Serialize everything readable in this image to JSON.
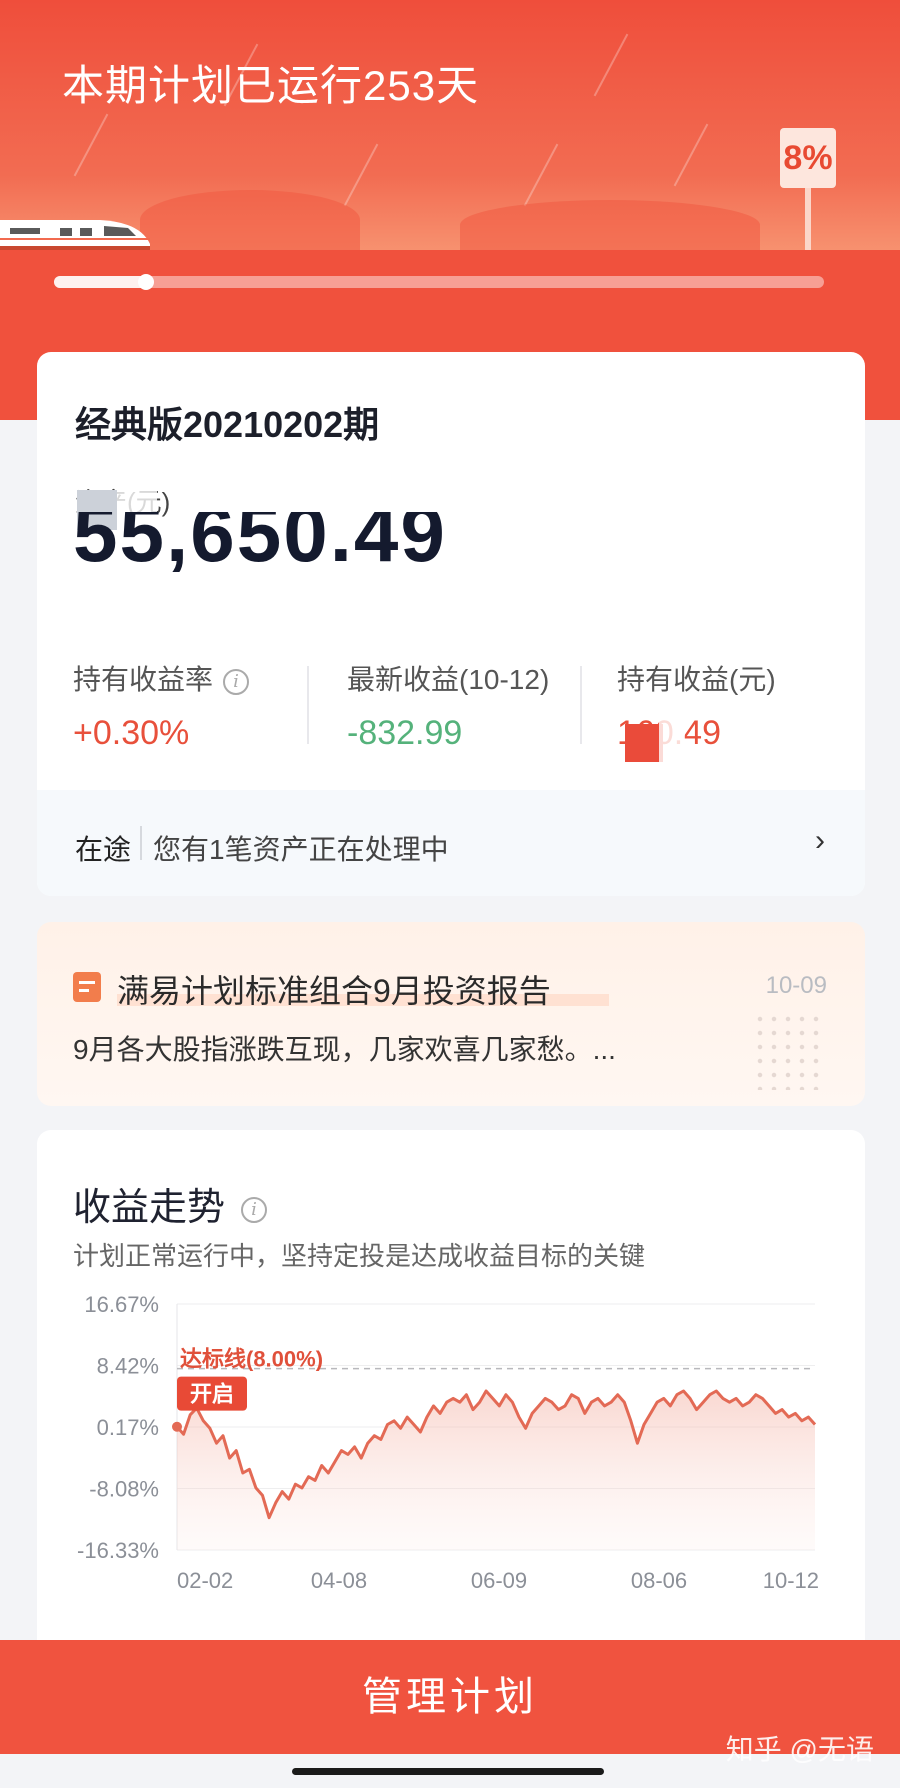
{
  "header": {
    "title": "本期计划已运行253天",
    "target_sign": "8%",
    "progress_fraction": 0.12
  },
  "asset_card": {
    "plan_name": "经典版20210202期",
    "asset_label": "资产(元)",
    "asset_value": "55,650.49",
    "stats": [
      {
        "label": "持有收益率",
        "value": "+0.30%",
        "color": "red",
        "has_info": true
      },
      {
        "label": "最新收益(10-12)",
        "value": "-832.99",
        "color": "green",
        "has_info": false
      },
      {
        "label": "持有收益(元)",
        "value": "160.49",
        "color": "red",
        "has_info": false
      }
    ],
    "in_progress": {
      "tag": "在途",
      "text": "您有1笔资产正在处理中",
      "arrow": "›"
    }
  },
  "report": {
    "title": "满易计划标准组合9月投资报告",
    "date": "10-09",
    "summary": "9月各大股指涨跌互现，几家欢喜几家愁。..."
  },
  "chart_section": {
    "title": "收益走势",
    "subtitle": "计划正常运行中，坚持定投是达成收益目标的关键",
    "start_tag": "开启",
    "target_label": "达标线(8.00%)"
  },
  "chart_data": {
    "type": "area",
    "y_ticks": [
      "16.67%",
      "8.42%",
      "0.17%",
      "-8.08%",
      "-16.33%"
    ],
    "ylim": [
      -16.33,
      16.67
    ],
    "x_ticks": [
      "02-02",
      "04-08",
      "06-09",
      "08-06",
      "10-12"
    ],
    "target_line": 8.0,
    "line_color": "#e36a55",
    "series": [
      {
        "values": [
          0.2,
          -0.8,
          1.8,
          2.7,
          1.0,
          0.0,
          -2.0,
          -1.0,
          -4.0,
          -3.0,
          -6.0,
          -5.5,
          -8.0,
          -9.0,
          -12.0,
          -10.0,
          -8.5,
          -9.5,
          -7.5,
          -8.0,
          -6.5,
          -7.0,
          -5.0,
          -6.0,
          -4.5,
          -3.0,
          -3.5,
          -2.5,
          -4.0,
          -2.0,
          -1.0,
          -1.5,
          0.5,
          1.0,
          0.0,
          1.5,
          0.5,
          -0.5,
          1.5,
          3.0,
          2.0,
          3.5,
          4.0,
          3.5,
          4.5,
          2.5,
          3.5,
          5.0,
          4.0,
          3.0,
          4.5,
          3.5,
          1.5,
          0.0,
          2.0,
          3.0,
          4.0,
          3.5,
          2.5,
          3.0,
          4.5,
          4.0,
          2.0,
          3.5,
          4.0,
          3.0,
          3.5,
          4.5,
          3.5,
          1.0,
          -2.0,
          0.5,
          2.0,
          3.5,
          4.0,
          3.0,
          4.5,
          5.0,
          4.0,
          2.5,
          3.5,
          4.5,
          5.0,
          4.0,
          3.5,
          4.0,
          3.0,
          3.5,
          4.5,
          4.0,
          3.0,
          2.0,
          2.5,
          1.5,
          2.0,
          1.0,
          1.5,
          0.5
        ]
      }
    ]
  },
  "bottom": {
    "button": "管理计划",
    "watermark": "知乎 @无语"
  }
}
